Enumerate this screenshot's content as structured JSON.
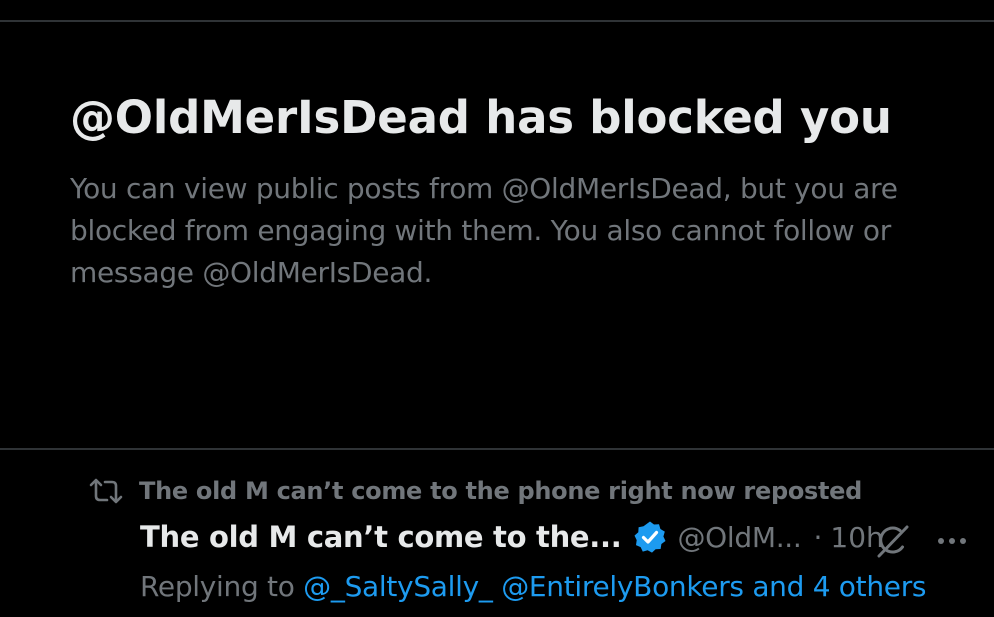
{
  "blocked": {
    "title": "@OldMerIsDead has blocked you",
    "description": "You can view public posts from @OldMerIsDead, but you are blocked from engaging with them. You also cannot follow or message @OldMerIsDead."
  },
  "post": {
    "repost_text": "The old M can’t come to the phone right now reposted",
    "author_name": "The old M can’t come to the...",
    "handle": "@OldM...",
    "dot": "·",
    "time": "10h",
    "replying_prefix": "Replying to",
    "mention_1": "@_SaltySally_",
    "mention_2": "@EntirelyBonkers",
    "others": "and 4 others"
  },
  "icons": {
    "repost": "repost-icon",
    "verified": "verified-badge-icon",
    "grok": "grok-icon",
    "more": "more-options-icon"
  },
  "colors": {
    "background": "#000000",
    "primary_text": "#e7e9ea",
    "secondary_text": "#71767b",
    "link": "#1d9bf0",
    "divider": "#2f3336"
  }
}
